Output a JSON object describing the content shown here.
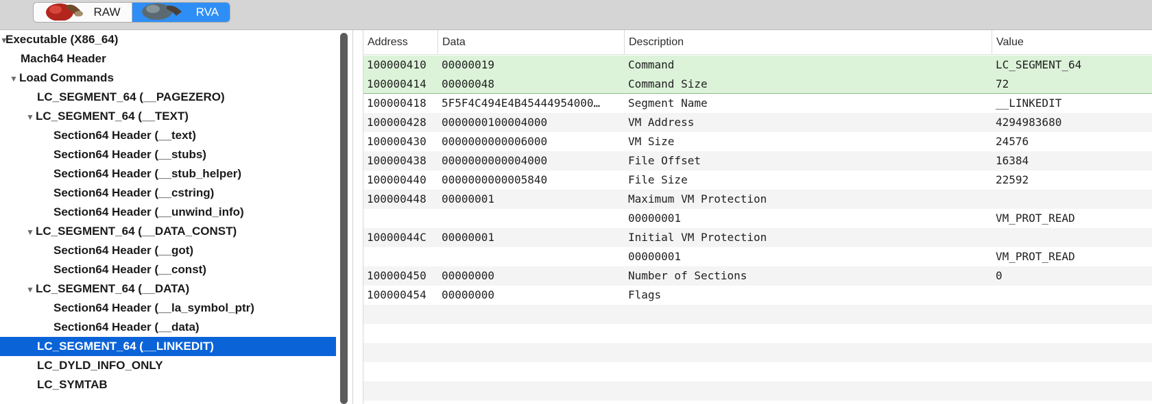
{
  "toolbar": {
    "raw_label": "RAW",
    "rva_label": "RVA",
    "active": "RVA"
  },
  "tree": {
    "items": [
      {
        "label": "Executable  (X86_64)",
        "expanded": true
      },
      {
        "label": "Mach64 Header"
      },
      {
        "label": "Load Commands",
        "expanded": true
      },
      {
        "label": "LC_SEGMENT_64 (__PAGEZERO)"
      },
      {
        "label": "LC_SEGMENT_64 (__TEXT)",
        "expanded": true
      },
      {
        "label": "Section64 Header (__text)"
      },
      {
        "label": "Section64 Header (__stubs)"
      },
      {
        "label": "Section64 Header (__stub_helper)"
      },
      {
        "label": "Section64 Header (__cstring)"
      },
      {
        "label": "Section64 Header (__unwind_info)"
      },
      {
        "label": "LC_SEGMENT_64 (__DATA_CONST)",
        "expanded": true
      },
      {
        "label": "Section64 Header (__got)"
      },
      {
        "label": "Section64 Header (__const)"
      },
      {
        "label": "LC_SEGMENT_64 (__DATA)",
        "expanded": true
      },
      {
        "label": "Section64 Header (__la_symbol_ptr)"
      },
      {
        "label": "Section64 Header (__data)"
      },
      {
        "label": "LC_SEGMENT_64 (__LINKEDIT)",
        "selected": true
      },
      {
        "label": "LC_DYLD_INFO_ONLY"
      },
      {
        "label": "LC_SYMTAB"
      }
    ]
  },
  "table": {
    "headers": {
      "address": "Address",
      "data": "Data",
      "description": "Description",
      "value": "Value"
    },
    "rows": [
      {
        "address": "100000410",
        "data": "00000019",
        "description": "Command",
        "value": "LC_SEGMENT_64",
        "highlight": true
      },
      {
        "address": "100000414",
        "data": "00000048",
        "description": "Command Size",
        "value": "72",
        "highlight": true
      },
      {
        "address": "100000418",
        "data": "5F5F4C494E4B45444954000…",
        "description": "Segment Name",
        "value": "__LINKEDIT"
      },
      {
        "address": "100000428",
        "data": "0000000100004000",
        "description": "VM Address",
        "value": "4294983680"
      },
      {
        "address": "100000430",
        "data": "0000000000006000",
        "description": "VM Size",
        "value": "24576"
      },
      {
        "address": "100000438",
        "data": "0000000000004000",
        "description": "File Offset",
        "value": "16384"
      },
      {
        "address": "100000440",
        "data": "0000000000005840",
        "description": "File Size",
        "value": "22592"
      },
      {
        "address": "100000448",
        "data": "00000001",
        "description": "Maximum VM Protection",
        "value": ""
      },
      {
        "address": "",
        "data": "",
        "description": "00000001",
        "value": "VM_PROT_READ"
      },
      {
        "address": "10000044C",
        "data": "00000001",
        "description": "Initial VM Protection",
        "value": ""
      },
      {
        "address": "",
        "data": "",
        "description": "00000001",
        "value": "VM_PROT_READ"
      },
      {
        "address": "100000450",
        "data": "00000000",
        "description": "Number of Sections",
        "value": "0"
      },
      {
        "address": "100000454",
        "data": "00000000",
        "description": "Flags",
        "value": ""
      }
    ]
  },
  "colors": {
    "accent": "#2f8ef5",
    "selection": "#0b63d8",
    "highlight_row": "#dcf3d9"
  }
}
